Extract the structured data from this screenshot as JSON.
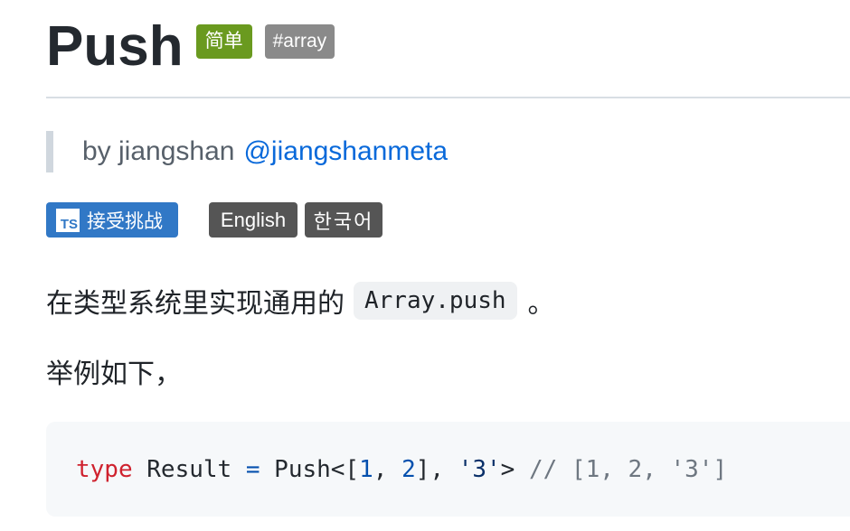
{
  "header": {
    "title": "Push",
    "difficulty_badge": "简单",
    "tag_badge": "#array"
  },
  "author": {
    "prefix": "by jiangshan",
    "handle": "@jiangshanmeta"
  },
  "buttons": {
    "ts_icon": "TS",
    "take_challenge": "接受挑战",
    "english": "English",
    "korean": "한국어"
  },
  "description": {
    "text_before": "在类型系统里实现通用的",
    "code": "Array.push",
    "text_after": "。",
    "example_intro": "举例如下，"
  },
  "code_example": {
    "keyword": "type",
    "ident": " Result ",
    "op": "=",
    "generic_open": " Push<[",
    "num1": "1",
    "comma1": ", ",
    "num2": "2",
    "bracket_close": "], ",
    "str": "'3'",
    "generic_close": ">",
    "comment": " // [1, 2, '3']"
  },
  "colors": {
    "difficulty_badge": "#6a9a1f",
    "tag_badge": "#8a8a8a",
    "ts_button": "#3178c6",
    "lang_button": "#555555",
    "link": "#0969da"
  }
}
